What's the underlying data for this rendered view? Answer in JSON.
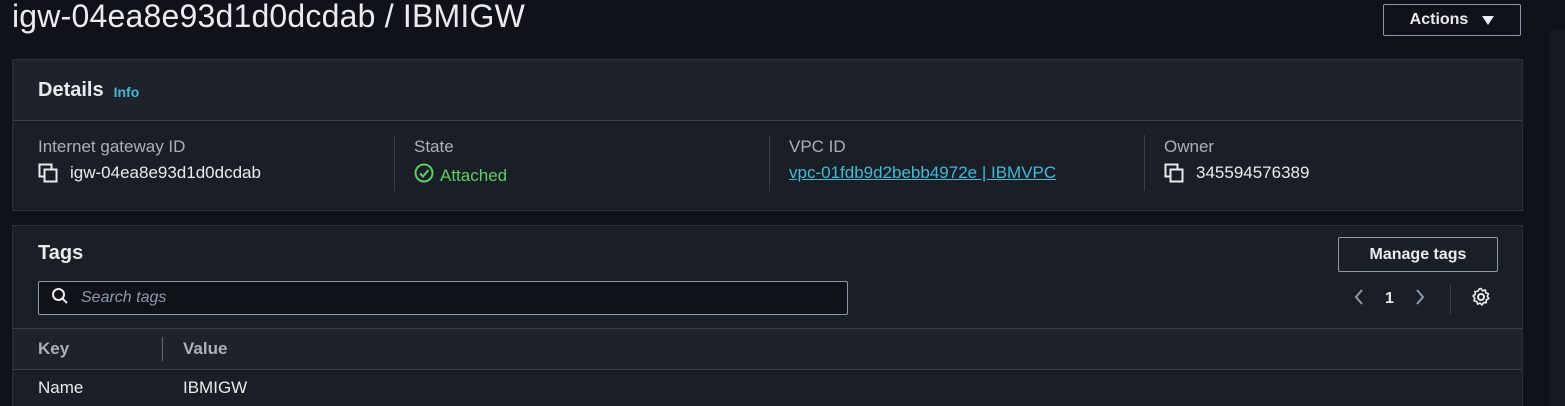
{
  "header": {
    "title": "igw-04ea8e93d1d0dcdab / IBMIGW",
    "actions_label": "Actions"
  },
  "details": {
    "title": "Details",
    "info_label": "Info",
    "fields": {
      "gateway_id": {
        "label": "Internet gateway ID",
        "value": "igw-04ea8e93d1d0dcdab",
        "icon": "copy-icon"
      },
      "state": {
        "label": "State",
        "value": "Attached",
        "icon": "check-circle-icon",
        "color": "#5fcf65"
      },
      "vpc_id": {
        "label": "VPC ID",
        "value": "vpc-01fdb9d2bebb4972e | IBMVPC"
      },
      "owner": {
        "label": "Owner",
        "value": "345594576389",
        "icon": "copy-icon"
      }
    }
  },
  "tags": {
    "title": "Tags",
    "manage_label": "Manage tags",
    "search_placeholder": "Search tags",
    "page": "1",
    "columns": {
      "key": "Key",
      "value": "Value"
    },
    "rows": [
      {
        "key": "Name",
        "value": "IBMIGW"
      }
    ]
  },
  "colors": {
    "background": "#0f1319",
    "panel": "#1a1e26",
    "link": "#44b9d6",
    "success": "#5fcf65"
  }
}
